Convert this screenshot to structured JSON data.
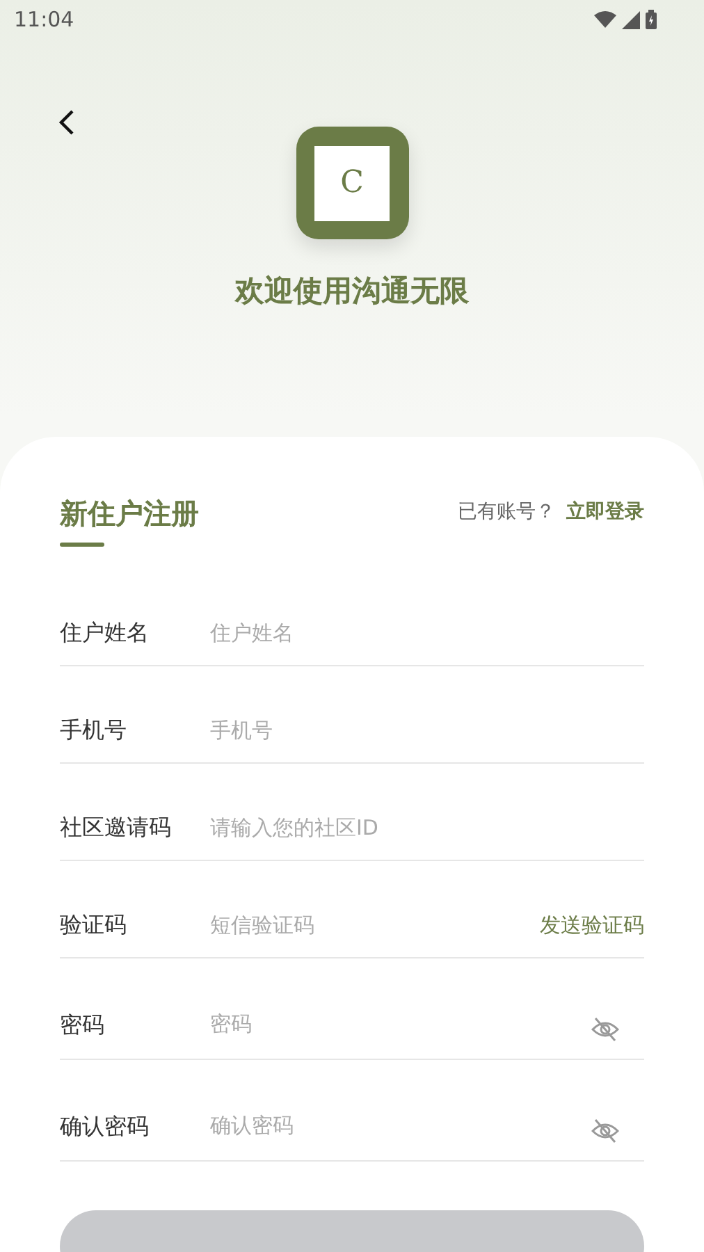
{
  "status_bar": {
    "time": "11:04"
  },
  "header": {
    "logo_letter": "C",
    "welcome": "欢迎使用沟通无限"
  },
  "form": {
    "title": "新住户注册",
    "login_prompt": "已有账号？",
    "login_link": "立即登录",
    "fields": [
      {
        "kind": "text",
        "label": "住户姓名",
        "placeholder": "住户姓名"
      },
      {
        "kind": "text",
        "label": "手机号",
        "placeholder": "手机号"
      },
      {
        "kind": "text",
        "label": "社区邀请码",
        "placeholder": "请输入您的社区ID"
      },
      {
        "kind": "code",
        "label": "验证码",
        "placeholder": "短信验证码",
        "action": "发送验证码"
      },
      {
        "kind": "password",
        "label": "密码",
        "placeholder": "密码",
        "visible": false
      },
      {
        "kind": "password",
        "label": "确认密码",
        "placeholder": "确认密码",
        "visible": false
      }
    ],
    "submit": {
      "disabled": true
    }
  }
}
